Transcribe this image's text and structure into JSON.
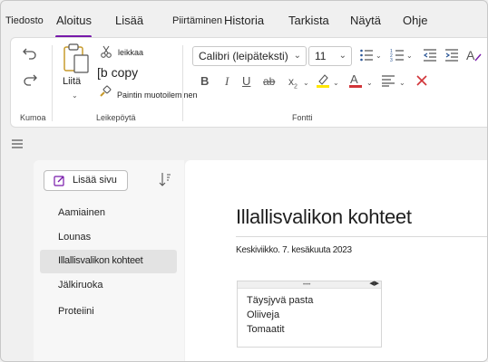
{
  "menu": {
    "tabs": [
      {
        "label": "Tiedosto"
      },
      {
        "label": "Aloitus"
      },
      {
        "label": "Lisää"
      },
      {
        "label": "Piirtäminen"
      },
      {
        "label": "Historia"
      },
      {
        "label": "Tarkista"
      },
      {
        "label": "Näytä"
      },
      {
        "label": "Ohje"
      }
    ],
    "active_tab": "Aloitus"
  },
  "ribbon": {
    "undo_group_label": "Kumoa",
    "clipboard": {
      "paste_label": "Liitä",
      "cut_label": "leikkaa",
      "copy_label": "[b copy",
      "format_painter_label": "Paintin muotoileminen",
      "group_label": "Leikepöytä"
    },
    "font": {
      "font_name": "Calibri (leipäteksti)",
      "font_size": "11",
      "group_label": "Fontti"
    },
    "colors": {
      "highlight": "#ffe600",
      "font_color": "#d13438",
      "clear_format": "#d13438",
      "accent": "#7719aa"
    }
  },
  "pages_panel": {
    "add_page_label": "Lisää sivu",
    "pages": [
      {
        "label": "Aamiainen"
      },
      {
        "label": "Lounas"
      },
      {
        "label": "Illallisvalikon kohteet"
      },
      {
        "label": "Jälkiruoka"
      },
      {
        "label": "Proteiini"
      }
    ],
    "selected_index": 2
  },
  "page": {
    "title": "Illallisvalikon kohteet",
    "date": "Keskiviikko. 7. kesäkuuta 2023",
    "note_lines": [
      "Täysjyvä pasta",
      "Oliiveja",
      "Tomaatit"
    ]
  }
}
